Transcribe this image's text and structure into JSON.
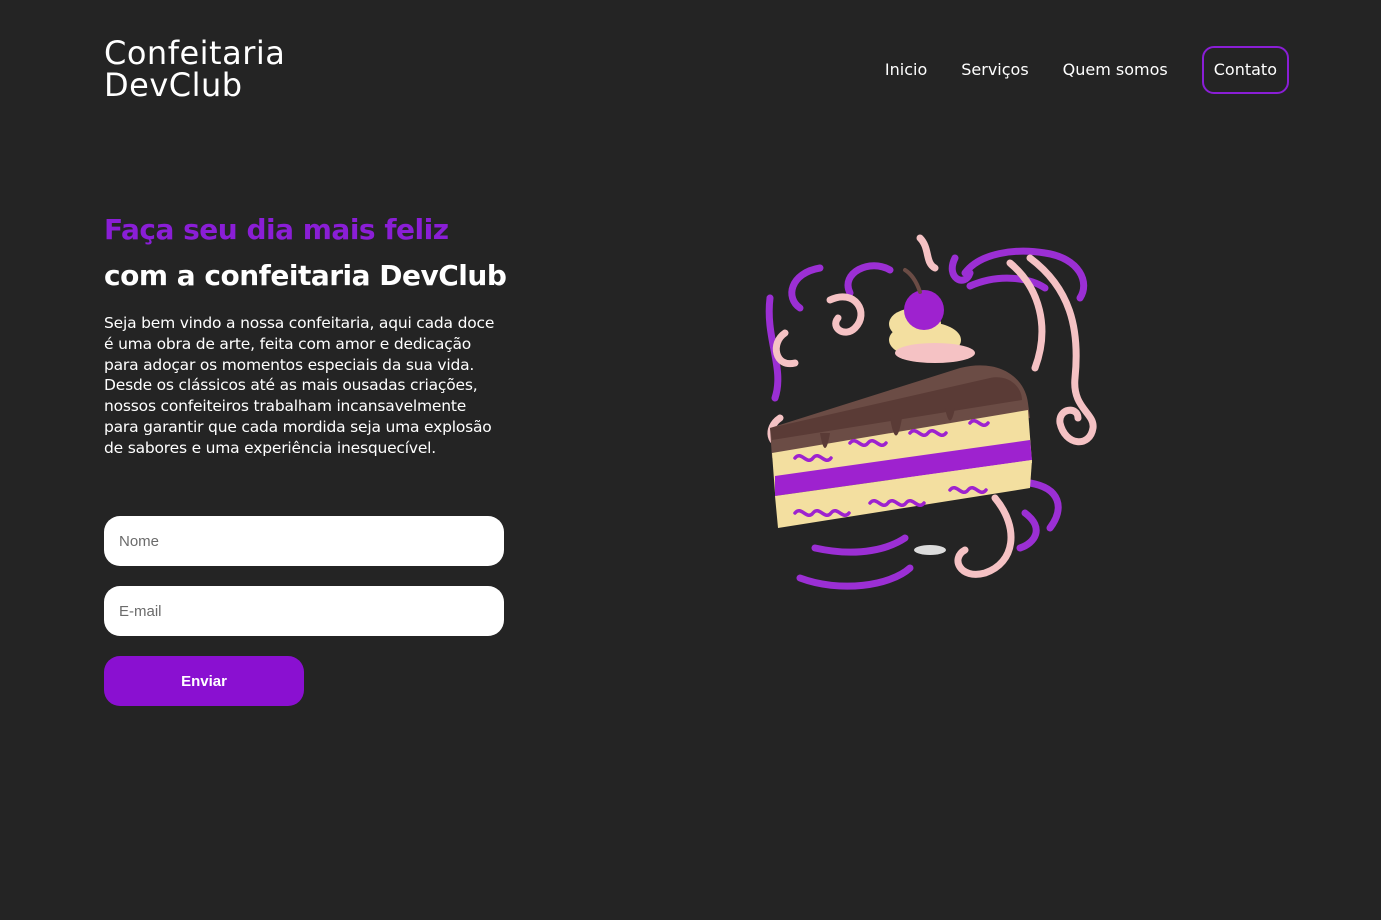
{
  "header": {
    "logo_line1": "Confeitaria",
    "logo_line2": "DevClub",
    "nav": {
      "home": "Inicio",
      "services": "Serviços",
      "about": "Quem somos",
      "contact": "Contato"
    }
  },
  "hero": {
    "title_line1": "Faça seu dia mais feliz",
    "title_line2": "com a confeitaria DevClub",
    "text": "Seja bem vindo a nossa confeitaria, aqui cada doce é uma obra de arte, feita com amor e dedicação para adoçar os momentos especiais da sua vida. Desde os clássicos até as mais ousadas criações, nossos confeiteiros trabalham incansavelmente para garantir que cada mordida seja uma explosão de sabores e uma experiência inesquecível."
  },
  "form": {
    "name_placeholder": "Nome",
    "email_placeholder": "E-mail",
    "submit_label": "Enviar"
  },
  "colors": {
    "background": "#242424",
    "accent": "#8a1ed6",
    "button": "#8a10d1"
  },
  "illustration": {
    "icon": "cake-slice-illustration"
  }
}
